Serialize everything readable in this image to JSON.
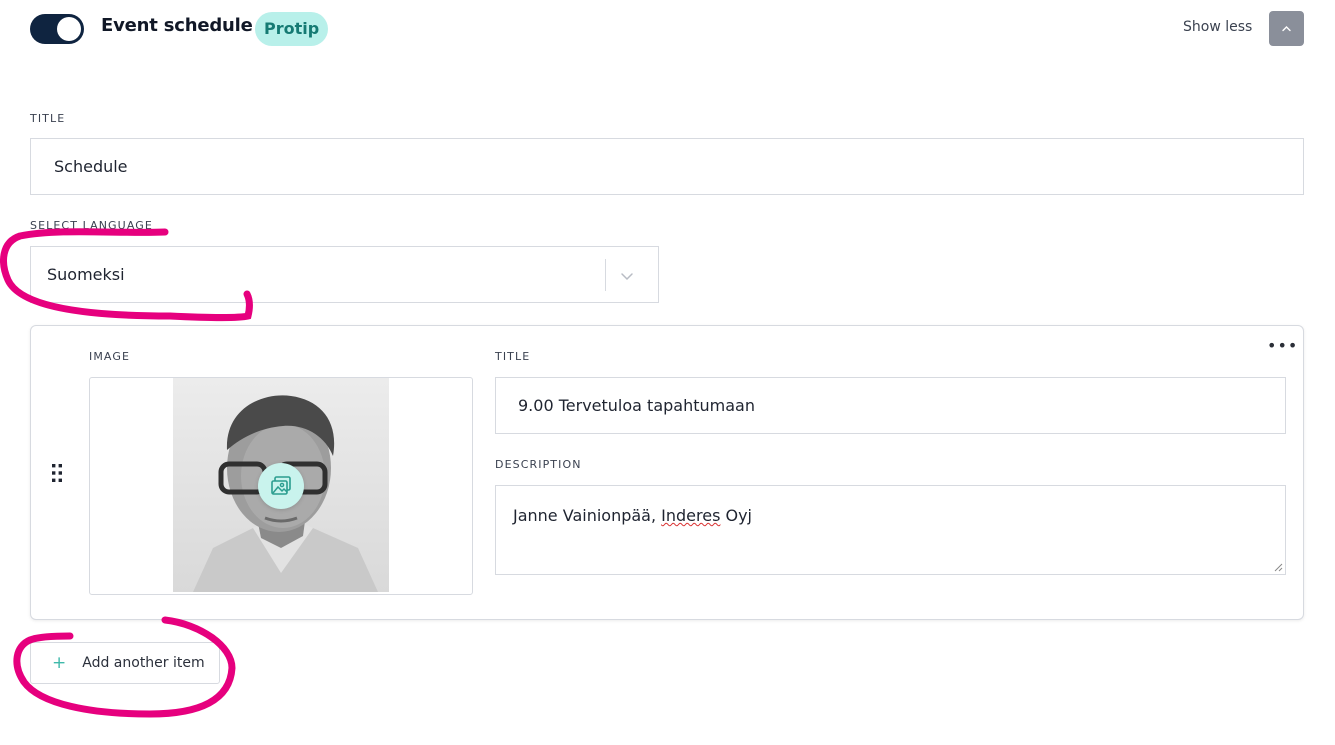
{
  "header": {
    "section_title": "Event schedule",
    "badge": "Protip",
    "show_less": "Show less",
    "toggle_state": "on"
  },
  "form": {
    "title_label": "TITLE",
    "title_value": "Schedule",
    "language_label": "SELECT LANGUAGE",
    "language_value": "Suomeksi"
  },
  "item": {
    "image_label": "IMAGE",
    "title_label": "TITLE",
    "title_value": "9.00 Tervetuloa tapahtumaan",
    "description_label": "DESCRIPTION",
    "description_prefix": "Janne Vainionpää, ",
    "description_misspelled": "Inderes",
    "description_suffix": " Oyj"
  },
  "actions": {
    "add_item": "Add another item"
  },
  "icons": {
    "collapse": "chevron-up-icon",
    "select": "chevron-down-icon",
    "menu": "more-horizontal-icon",
    "drag": "drag-handle-icon",
    "image": "image-icon",
    "add": "plus-icon"
  },
  "colors": {
    "toggle": "#0f2440",
    "badge_bg": "#b8f0ea",
    "badge_text": "#157a73",
    "accent": "#3fb9aa",
    "annotation": "#e6007e"
  }
}
